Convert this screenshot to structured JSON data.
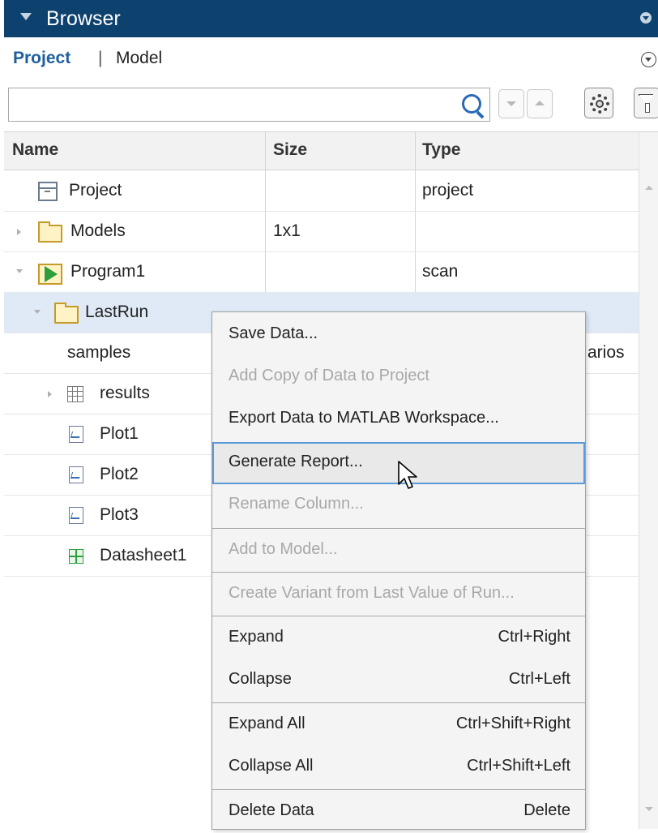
{
  "window": {
    "title": "Browser"
  },
  "tabs": {
    "project": "Project",
    "separator": "|",
    "model": "Model"
  },
  "search": {
    "value": "",
    "placeholder": ""
  },
  "table": {
    "columns": [
      "Name",
      "Size",
      "Type"
    ],
    "rows": [
      {
        "name": "Project",
        "size": "",
        "type": "project",
        "icon": "project-icon",
        "expander": "none"
      },
      {
        "name": "Models",
        "size": "1x1",
        "type": "",
        "icon": "folder-icon",
        "expander": "collapsed"
      },
      {
        "name": "Program1",
        "size": "",
        "type": "scan",
        "icon": "program-icon",
        "expander": "expanded"
      },
      {
        "name": "LastRun",
        "size": "",
        "type": "",
        "icon": "folder-icon",
        "expander": "expanded",
        "selected": true
      },
      {
        "name": "samples",
        "size": "",
        "type": "arios",
        "icon": "none",
        "expander": "none"
      },
      {
        "name": "results",
        "size": "",
        "type": "",
        "icon": "table-icon",
        "expander": "collapsed"
      },
      {
        "name": "Plot1",
        "size": "",
        "type": "",
        "icon": "plot-icon",
        "expander": "none"
      },
      {
        "name": "Plot2",
        "size": "",
        "type": "",
        "icon": "plot-icon",
        "expander": "none"
      },
      {
        "name": "Plot3",
        "size": "",
        "type": "",
        "icon": "plot-icon",
        "expander": "none"
      },
      {
        "name": "Datasheet1",
        "size": "",
        "type": "",
        "icon": "datasheet-icon",
        "expander": "none"
      }
    ]
  },
  "context_menu": {
    "items": [
      {
        "label": "Save Data...",
        "shortcut": "",
        "enabled": true
      },
      {
        "label": "Add Copy of Data to Project",
        "shortcut": "",
        "enabled": false
      },
      {
        "label": "Export Data to MATLAB Workspace...",
        "shortcut": "",
        "enabled": true
      },
      {
        "label": "Generate Report...",
        "shortcut": "",
        "enabled": true,
        "highlighted": true
      },
      {
        "label": "Rename Column...",
        "shortcut": "",
        "enabled": false
      },
      {
        "label": "Add to Model...",
        "shortcut": "",
        "enabled": false
      },
      {
        "label": "Create Variant from Last Value of Run...",
        "shortcut": "",
        "enabled": false
      },
      {
        "label": "Expand",
        "shortcut": "Ctrl+Right",
        "enabled": true
      },
      {
        "label": "Collapse",
        "shortcut": "Ctrl+Left",
        "enabled": true
      },
      {
        "label": "Expand All",
        "shortcut": "Ctrl+Shift+Right",
        "enabled": true
      },
      {
        "label": "Collapse All",
        "shortcut": "Ctrl+Shift+Left",
        "enabled": true
      },
      {
        "label": "Delete Data",
        "shortcut": "Delete",
        "enabled": true
      }
    ]
  },
  "colors": {
    "titlebar": "#0d416e",
    "tab_active": "#1f5f9e",
    "selection": "#dfeaf6",
    "menu_highlight_border": "#5a9bd8"
  }
}
